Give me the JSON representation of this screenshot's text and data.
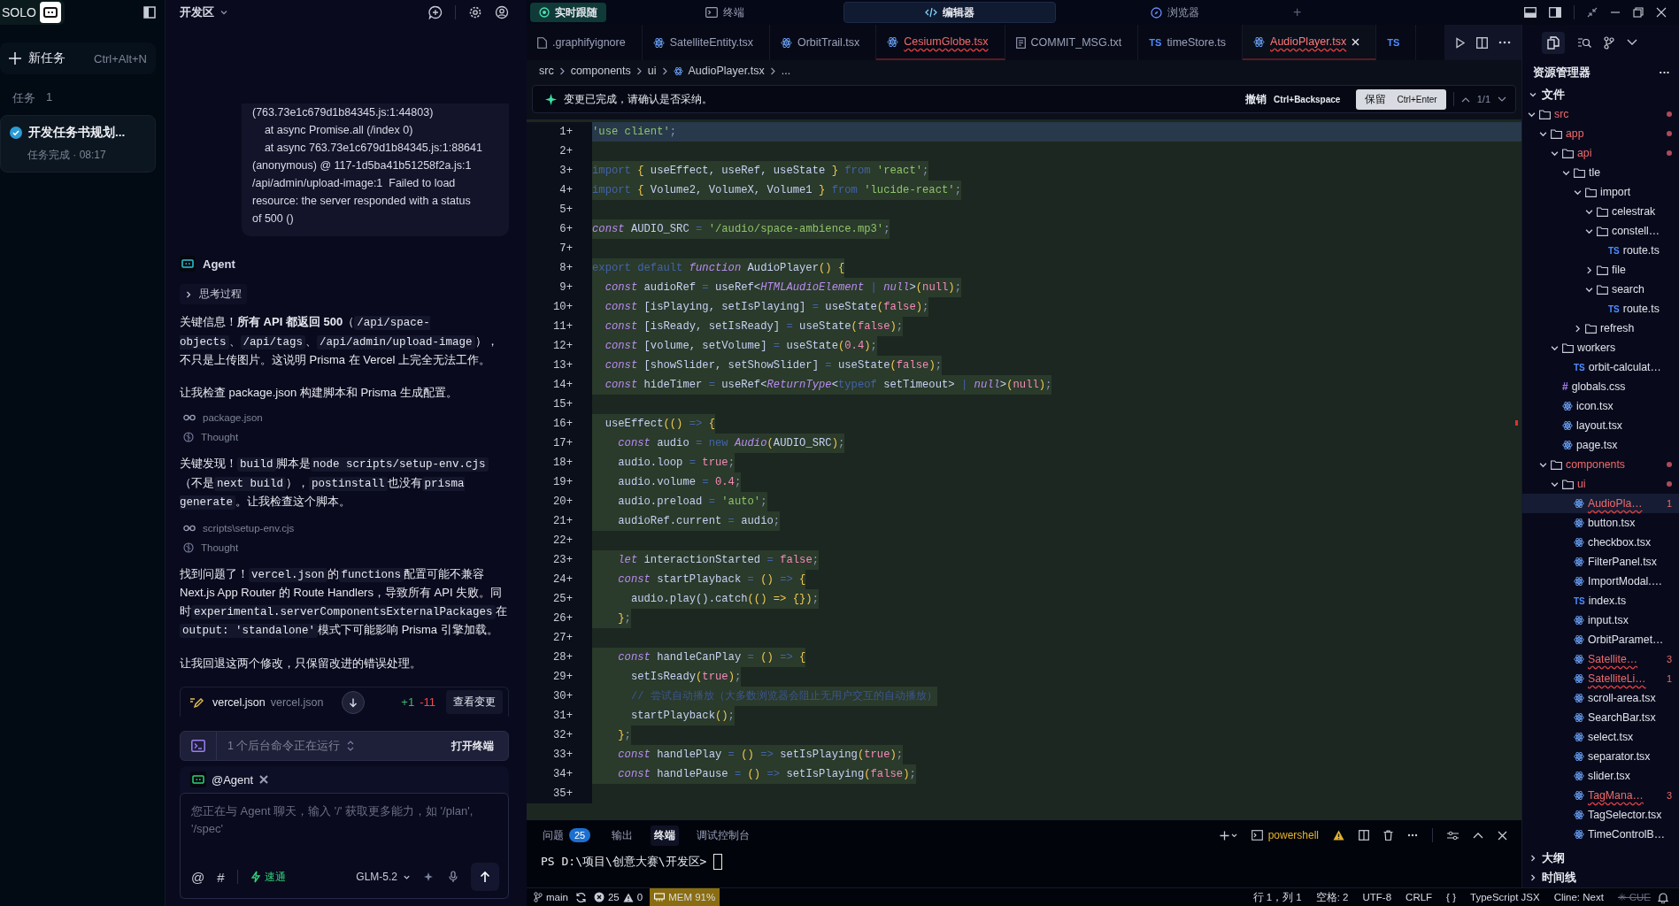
{
  "sidebar": {
    "brand": "SOLO",
    "new_task": {
      "label": "新任务",
      "shortcut": "Ctrl+Alt+N"
    },
    "tasks_label": "任务",
    "tasks_count": "1",
    "tasks": [
      {
        "title": "开发任务书规划...",
        "status": "任务完成 · 08:17",
        "done": true,
        "selected": true
      }
    ]
  },
  "chat": {
    "workspace": "开发区",
    "log": "(763.73e1c679d1b84345.js:1:44803)\n    at async Promise.all (/index 0)\n    at async 763.73e1c679d1b84345.js:1:88641\n(anonymous) @ 117-1d5ba41b51258f2a.js:1\n/api/admin/upload-image:1  Failed to load\nresource: the server responded with a status\nof 500 ()",
    "agent": "Agent",
    "thinking": {
      "label": "思考过程",
      "expanded": false
    },
    "items": [
      {
        "kind": "paragraph",
        "parts": [
          {
            "kind": "plain",
            "text": "关键信息！"
          },
          {
            "kind": "bold",
            "text": "所有 API 都返回 500"
          },
          {
            "kind": "plain",
            "text": "（"
          },
          {
            "kind": "code",
            "text": "/api/space-objects"
          },
          {
            "kind": "plain",
            "text": "、"
          },
          {
            "kind": "code",
            "text": "/api/tags"
          },
          {
            "kind": "plain",
            "text": "、"
          },
          {
            "kind": "code",
            "text": "/api/admin/upload-image"
          },
          {
            "kind": "plain",
            "text": "），不只是上传图片。这说明 Prisma 在 Vercel 上完全无法工作。"
          }
        ]
      },
      {
        "kind": "paragraph",
        "parts": [
          {
            "kind": "plain",
            "text": "让我检查 package.json 构建脚本和 Prisma 生成配置。"
          }
        ]
      },
      {
        "kind": "tool",
        "text": "package.json"
      },
      {
        "kind": "thought",
        "text": "Thought"
      },
      {
        "kind": "paragraph",
        "parts": [
          {
            "kind": "plain",
            "text": "关键发现！"
          },
          {
            "kind": "code",
            "text": "build"
          },
          {
            "kind": "plain",
            "text": "脚本是"
          },
          {
            "kind": "code",
            "text": "node scripts/setup-env.cjs"
          },
          {
            "kind": "plain",
            "text": "（不是"
          },
          {
            "kind": "code",
            "text": "next build"
          },
          {
            "kind": "plain",
            "text": "），"
          },
          {
            "kind": "code",
            "text": "postinstall"
          },
          {
            "kind": "plain",
            "text": "也没有"
          },
          {
            "kind": "code",
            "text": "prisma generate"
          },
          {
            "kind": "plain",
            "text": "。让我检查这个脚本。"
          }
        ]
      },
      {
        "kind": "tool",
        "text": "scripts\\setup-env.cjs"
      },
      {
        "kind": "thought",
        "text": "Thought"
      },
      {
        "kind": "paragraph",
        "parts": [
          {
            "kind": "plain",
            "text": "找到问题了！"
          },
          {
            "kind": "code",
            "text": "vercel.json"
          },
          {
            "kind": "plain",
            "text": "的"
          },
          {
            "kind": "code",
            "text": "functions"
          },
          {
            "kind": "plain",
            "text": "配置可能不兼容 Next.js App Router 的 Route Handlers，导致所有 API 失败。同时"
          },
          {
            "kind": "code",
            "text": "experimental.serverComponentsExternalPackages"
          },
          {
            "kind": "plain",
            "text": "在"
          },
          {
            "kind": "code",
            "text": "output: 'standalone'"
          },
          {
            "kind": "plain",
            "text": "模式下可能影响 Prisma 引擎加载。"
          }
        ]
      },
      {
        "kind": "paragraph",
        "parts": [
          {
            "kind": "plain",
            "text": "让我回退这两个修改，只保留改进的错误处理。"
          }
        ]
      }
    ],
    "change": {
      "file": "vercel.json",
      "path": "vercel.json",
      "added": "+1",
      "removed": "-11",
      "action": "查看变更"
    },
    "background": {
      "label": "1 个后台命令正在运行",
      "action": "打开终端"
    },
    "input": {
      "mention": "@Agent",
      "placeholder": "您正在与 Agent 聊天，输入 '/' 获取更多能力，如 '/plan', '/spec'",
      "at": "@",
      "hash": "#",
      "mode": "速通",
      "model": "GLM-5.2"
    }
  },
  "topbar": {
    "follow": "实时跟随",
    "tabs": [
      {
        "label": "终端",
        "kind": "terminal",
        "selected": false
      },
      {
        "label": "编辑器",
        "kind": "code",
        "selected": true
      },
      {
        "label": "浏览器",
        "kind": "browser",
        "selected": false
      }
    ],
    "add": "+"
  },
  "file_tabs": [
    {
      "name": ".graphifyignore",
      "kind": "file",
      "error": false,
      "selected": false
    },
    {
      "name": "SatelliteEntity.tsx",
      "kind": "react",
      "error": false,
      "selected": false
    },
    {
      "name": "OrbitTrail.tsx",
      "kind": "react",
      "error": false,
      "selected": false
    },
    {
      "name": "CesiumGlobe.tsx",
      "kind": "react",
      "error": true,
      "selected": false
    },
    {
      "name": "COMMIT_MSG.txt",
      "kind": "doc",
      "error": false,
      "selected": false
    },
    {
      "name": "timeStore.ts",
      "kind": "ts",
      "mark": "TS",
      "error": false,
      "selected": false
    },
    {
      "name": "AudioPlayer.tsx",
      "kind": "react",
      "error": true,
      "selected": true
    },
    {
      "kind": "ts",
      "mark": "TS",
      "error": false,
      "selected": false
    }
  ],
  "breadcrumb": [
    "src",
    "components",
    "ui",
    "AudioPlayer.tsx",
    "..."
  ],
  "banner": {
    "message": "变更已完成，请确认是否采纳。",
    "undo": "撤销",
    "undo_key": "Ctrl+Backspace",
    "keep": "保留",
    "keep_key": "Ctrl+Enter",
    "count": "1/1"
  },
  "code": [
    {
      "gutter": "1+",
      "tokens": [
        {
          "kind": "str",
          "text": "'use client'"
        },
        {
          "kind": "p",
          "text": ";"
        }
      ]
    },
    {
      "gutter": "2+"
    },
    {
      "gutter": "3+",
      "tokens": [
        {
          "kind": "kw",
          "text": "import "
        },
        {
          "kind": "br",
          "text": "{ "
        },
        {
          "kind": "id",
          "text": "useEffect, useRef, useState "
        },
        {
          "kind": "br",
          "text": "} "
        },
        {
          "kind": "kw",
          "text": "from "
        },
        {
          "kind": "str",
          "text": "'react'"
        },
        {
          "kind": "p",
          "text": ";"
        }
      ]
    },
    {
      "gutter": "4+",
      "tokens": [
        {
          "kind": "kw",
          "text": "import "
        },
        {
          "kind": "br",
          "text": "{ "
        },
        {
          "kind": "id",
          "text": "Volume2, VolumeX, Volume1 "
        },
        {
          "kind": "br",
          "text": "} "
        },
        {
          "kind": "kw",
          "text": "from "
        },
        {
          "kind": "str",
          "text": "'lucide-react'"
        },
        {
          "kind": "p",
          "text": ";"
        }
      ]
    },
    {
      "gutter": "5+"
    },
    {
      "gutter": "6+",
      "tokens": [
        {
          "kind": "st",
          "text": "const "
        },
        {
          "kind": "id",
          "text": "AUDIO_SRC "
        },
        {
          "kind": "kw",
          "text": "= "
        },
        {
          "kind": "str",
          "text": "'/audio/space-ambience.mp3'"
        },
        {
          "kind": "p",
          "text": ";"
        }
      ]
    },
    {
      "gutter": "7+"
    },
    {
      "gutter": "8+",
      "tokens": [
        {
          "kind": "kw",
          "text": "export default "
        },
        {
          "kind": "st",
          "text": "function "
        },
        {
          "kind": "id",
          "text": "AudioPlayer"
        },
        {
          "kind": "br",
          "text": "() {"
        }
      ]
    },
    {
      "gutter": "9+",
      "tokens": [
        {
          "kind": "st",
          "text": "  const "
        },
        {
          "kind": "id",
          "text": "audioRef "
        },
        {
          "kind": "kw",
          "text": "= "
        },
        {
          "kind": "id",
          "text": "useRef<"
        },
        {
          "kind": "ty",
          "text": "HTMLAudioElement "
        },
        {
          "kind": "kw",
          "text": "| "
        },
        {
          "kind": "ty",
          "text": "null"
        },
        {
          "kind": "id",
          "text": ">"
        },
        {
          "kind": "br",
          "text": "("
        },
        {
          "kind": "lit",
          "text": "null"
        },
        {
          "kind": "br",
          "text": ")"
        },
        {
          "kind": "p",
          "text": ";"
        }
      ]
    },
    {
      "gutter": "10+",
      "tokens": [
        {
          "kind": "st",
          "text": "  const "
        },
        {
          "kind": "id",
          "text": "[isPlaying, setIsPlaying] "
        },
        {
          "kind": "kw",
          "text": "= "
        },
        {
          "kind": "id",
          "text": "useState"
        },
        {
          "kind": "br",
          "text": "("
        },
        {
          "kind": "lit",
          "text": "false"
        },
        {
          "kind": "br",
          "text": ")"
        },
        {
          "kind": "p",
          "text": ";"
        }
      ]
    },
    {
      "gutter": "11+",
      "tokens": [
        {
          "kind": "st",
          "text": "  const "
        },
        {
          "kind": "id",
          "text": "[isReady, setIsReady] "
        },
        {
          "kind": "kw",
          "text": "= "
        },
        {
          "kind": "id",
          "text": "useState"
        },
        {
          "kind": "br",
          "text": "("
        },
        {
          "kind": "lit",
          "text": "false"
        },
        {
          "kind": "br",
          "text": ")"
        },
        {
          "kind": "p",
          "text": ";"
        }
      ]
    },
    {
      "gutter": "12+",
      "tokens": [
        {
          "kind": "st",
          "text": "  const "
        },
        {
          "kind": "id",
          "text": "[volume, setVolume] "
        },
        {
          "kind": "kw",
          "text": "= "
        },
        {
          "kind": "id",
          "text": "useState"
        },
        {
          "kind": "br",
          "text": "("
        },
        {
          "kind": "lit",
          "text": "0.4"
        },
        {
          "kind": "br",
          "text": ")"
        },
        {
          "kind": "p",
          "text": ";"
        }
      ]
    },
    {
      "gutter": "13+",
      "tokens": [
        {
          "kind": "st",
          "text": "  const "
        },
        {
          "kind": "id",
          "text": "[showSlider, setShowSlider] "
        },
        {
          "kind": "kw",
          "text": "= "
        },
        {
          "kind": "id",
          "text": "useState"
        },
        {
          "kind": "br",
          "text": "("
        },
        {
          "kind": "lit",
          "text": "false"
        },
        {
          "kind": "br",
          "text": ")"
        },
        {
          "kind": "p",
          "text": ";"
        }
      ]
    },
    {
      "gutter": "14+",
      "tokens": [
        {
          "kind": "st",
          "text": "  const "
        },
        {
          "kind": "id",
          "text": "hideTimer "
        },
        {
          "kind": "kw",
          "text": "= "
        },
        {
          "kind": "id",
          "text": "useRef<"
        },
        {
          "kind": "ty",
          "text": "ReturnType"
        },
        {
          "kind": "id",
          "text": "<"
        },
        {
          "kind": "kw",
          "text": "typeof "
        },
        {
          "kind": "id",
          "text": "setTimeout> "
        },
        {
          "kind": "kw",
          "text": "| "
        },
        {
          "kind": "ty",
          "text": "null"
        },
        {
          "kind": "id",
          "text": ">"
        },
        {
          "kind": "br",
          "text": "("
        },
        {
          "kind": "lit",
          "text": "null"
        },
        {
          "kind": "br",
          "text": ")"
        },
        {
          "kind": "p",
          "text": ";"
        }
      ]
    },
    {
      "gutter": "15+"
    },
    {
      "gutter": "16+",
      "tokens": [
        {
          "kind": "id",
          "text": "  useEffect"
        },
        {
          "kind": "br",
          "text": "(() "
        },
        {
          "kind": "kw",
          "text": "=> "
        },
        {
          "kind": "br",
          "text": "{"
        }
      ]
    },
    {
      "gutter": "17+",
      "tokens": [
        {
          "kind": "st",
          "text": "    const "
        },
        {
          "kind": "id",
          "text": "audio "
        },
        {
          "kind": "kw",
          "text": "= new "
        },
        {
          "kind": "ty",
          "text": "Audio"
        },
        {
          "kind": "br",
          "text": "("
        },
        {
          "kind": "id",
          "text": "AUDIO_SRC"
        },
        {
          "kind": "br",
          "text": ")"
        },
        {
          "kind": "p",
          "text": ";"
        }
      ]
    },
    {
      "gutter": "18+",
      "tokens": [
        {
          "kind": "id",
          "text": "    audio.loop "
        },
        {
          "kind": "kw",
          "text": "= "
        },
        {
          "kind": "lit",
          "text": "true"
        },
        {
          "kind": "p",
          "text": ";"
        }
      ]
    },
    {
      "gutter": "19+",
      "tokens": [
        {
          "kind": "id",
          "text": "    audio.volume "
        },
        {
          "kind": "kw",
          "text": "= "
        },
        {
          "kind": "lit",
          "text": "0.4"
        },
        {
          "kind": "p",
          "text": ";"
        }
      ]
    },
    {
      "gutter": "20+",
      "tokens": [
        {
          "kind": "id",
          "text": "    audio.preload "
        },
        {
          "kind": "kw",
          "text": "= "
        },
        {
          "kind": "str",
          "text": "'auto'"
        },
        {
          "kind": "p",
          "text": ";"
        }
      ]
    },
    {
      "gutter": "21+",
      "tokens": [
        {
          "kind": "id",
          "text": "    audioRef.current "
        },
        {
          "kind": "kw",
          "text": "= "
        },
        {
          "kind": "id",
          "text": "audio"
        },
        {
          "kind": "p",
          "text": ";"
        }
      ]
    },
    {
      "gutter": "22+"
    },
    {
      "gutter": "23+",
      "tokens": [
        {
          "kind": "st",
          "text": "    let "
        },
        {
          "kind": "id",
          "text": "interactionStarted "
        },
        {
          "kind": "kw",
          "text": "= "
        },
        {
          "kind": "lit",
          "text": "false"
        },
        {
          "kind": "p",
          "text": ";"
        }
      ]
    },
    {
      "gutter": "24+",
      "tokens": [
        {
          "kind": "st",
          "text": "    const "
        },
        {
          "kind": "id",
          "text": "startPlayback "
        },
        {
          "kind": "kw",
          "text": "= "
        },
        {
          "kind": "br",
          "text": "() "
        },
        {
          "kind": "kw",
          "text": "=> "
        },
        {
          "kind": "br",
          "text": "{"
        }
      ]
    },
    {
      "gutter": "25+",
      "tokens": [
        {
          "kind": "id",
          "text": "      audio.play().catch"
        },
        {
          "kind": "br",
          "text": "(() => {})"
        },
        {
          "kind": "p",
          "text": ";"
        }
      ]
    },
    {
      "gutter": "26+",
      "tokens": [
        {
          "kind": "br",
          "text": "    }"
        },
        {
          "kind": "p",
          "text": ";"
        }
      ]
    },
    {
      "gutter": "27+"
    },
    {
      "gutter": "28+",
      "tokens": [
        {
          "kind": "st",
          "text": "    const "
        },
        {
          "kind": "id",
          "text": "handleCanPlay "
        },
        {
          "kind": "kw",
          "text": "= "
        },
        {
          "kind": "br",
          "text": "() "
        },
        {
          "kind": "kw",
          "text": "=> "
        },
        {
          "kind": "br",
          "text": "{"
        }
      ]
    },
    {
      "gutter": "29+",
      "tokens": [
        {
          "kind": "id",
          "text": "      setIsReady"
        },
        {
          "kind": "br",
          "text": "("
        },
        {
          "kind": "lit",
          "text": "true"
        },
        {
          "kind": "br",
          "text": ")"
        },
        {
          "kind": "p",
          "text": ";"
        }
      ]
    },
    {
      "gutter": "30+",
      "tokens": [
        {
          "kind": "cm",
          "text": "      // 尝试自动播放（大多数浏览器会阻止无用户交互的自动播放）"
        }
      ]
    },
    {
      "gutter": "31+",
      "tokens": [
        {
          "kind": "id",
          "text": "      startPlayback"
        },
        {
          "kind": "br",
          "text": "()"
        },
        {
          "kind": "p",
          "text": ";"
        }
      ]
    },
    {
      "gutter": "32+",
      "tokens": [
        {
          "kind": "br",
          "text": "    }"
        },
        {
          "kind": "p",
          "text": ";"
        }
      ]
    },
    {
      "gutter": "33+",
      "tokens": [
        {
          "kind": "st",
          "text": "    const "
        },
        {
          "kind": "id",
          "text": "handlePlay "
        },
        {
          "kind": "kw",
          "text": "= "
        },
        {
          "kind": "br",
          "text": "() "
        },
        {
          "kind": "kw",
          "text": "=> "
        },
        {
          "kind": "id",
          "text": "setIsPlaying"
        },
        {
          "kind": "br",
          "text": "("
        },
        {
          "kind": "lit",
          "text": "true"
        },
        {
          "kind": "br",
          "text": ")"
        },
        {
          "kind": "p",
          "text": ";"
        }
      ]
    },
    {
      "gutter": "34+",
      "tokens": [
        {
          "kind": "st",
          "text": "    const "
        },
        {
          "kind": "id",
          "text": "handlePause "
        },
        {
          "kind": "kw",
          "text": "= "
        },
        {
          "kind": "br",
          "text": "() "
        },
        {
          "kind": "kw",
          "text": "=> "
        },
        {
          "kind": "id",
          "text": "setIsPlaying"
        },
        {
          "kind": "br",
          "text": "("
        },
        {
          "kind": "lit",
          "text": "false"
        },
        {
          "kind": "br",
          "text": ")"
        },
        {
          "kind": "p",
          "text": ";"
        }
      ]
    },
    {
      "gutter": "35+"
    }
  ],
  "panel": {
    "tabs": [
      {
        "label": "问题",
        "badge": "25",
        "selected": false
      },
      {
        "label": "输出",
        "selected": false
      },
      {
        "label": "终端",
        "selected": true
      },
      {
        "label": "调试控制台",
        "selected": false
      }
    ],
    "shell": "powershell",
    "prompt": "PS D:\\项目\\创意大赛\\开发区> "
  },
  "explorer": {
    "title": "资源管理器",
    "more": "···",
    "files": {
      "label": "文件",
      "expanded": true,
      "tree": [
        {
          "name": "src",
          "kind": "folder",
          "expanded": true,
          "modified": true,
          "selected": false,
          "children": [
            {
              "name": "app",
              "kind": "folder",
              "expanded": true,
              "modified": true,
              "selected": false,
              "children": [
                {
                  "name": "api",
                  "kind": "folder",
                  "expanded": true,
                  "modified": true,
                  "selected": false,
                  "children": [
                    {
                      "name": "tle",
                      "kind": "folder",
                      "expanded": true,
                      "modified": false,
                      "selected": false,
                      "children": [
                        {
                          "name": "import",
                          "kind": "folder",
                          "expanded": true,
                          "modified": false,
                          "selected": false,
                          "children": [
                            {
                              "name": "celestrak",
                              "kind": "folder",
                              "expanded": true,
                              "modified": false,
                              "selected": false
                            },
                            {
                              "name": "constell…",
                              "kind": "folder",
                              "expanded": true,
                              "modified": false,
                              "selected": false,
                              "children": [
                                {
                                  "name": "route.ts",
                                  "kind": "ts",
                                  "mark": "TS",
                                  "modified": false,
                                  "selected": false
                                }
                              ]
                            },
                            {
                              "name": "file",
                              "kind": "folder",
                              "expanded": false,
                              "modified": false,
                              "selected": false
                            },
                            {
                              "name": "search",
                              "kind": "folder",
                              "expanded": true,
                              "modified": false,
                              "selected": false,
                              "children": [
                                {
                                  "name": "route.ts",
                                  "kind": "ts",
                                  "mark": "TS",
                                  "modified": false,
                                  "selected": false
                                }
                              ]
                            }
                          ]
                        },
                        {
                          "name": "refresh",
                          "kind": "folder",
                          "expanded": false,
                          "modified": false,
                          "selected": false
                        }
                      ]
                    }
                  ]
                },
                {
                  "name": "workers",
                  "kind": "folder",
                  "expanded": true,
                  "modified": false,
                  "selected": false,
                  "children": [
                    {
                      "name": "orbit-calculat…",
                      "kind": "ts",
                      "mark": "TS",
                      "modified": false,
                      "selected": false
                    }
                  ]
                },
                {
                  "name": "globals.css",
                  "kind": "css",
                  "mark": "#",
                  "modified": false,
                  "selected": false
                },
                {
                  "name": "icon.tsx",
                  "kind": "react",
                  "modified": false,
                  "selected": false
                },
                {
                  "name": "layout.tsx",
                  "kind": "react",
                  "modified": false,
                  "selected": false
                },
                {
                  "name": "page.tsx",
                  "kind": "react",
                  "modified": false,
                  "selected": false
                }
              ]
            },
            {
              "name": "components",
              "kind": "folder",
              "expanded": true,
              "modified": true,
              "selected": false,
              "children": [
                {
                  "name": "ui",
                  "kind": "folder",
                  "expanded": true,
                  "modified": true,
                  "selected": false,
                  "children": [
                    {
                      "name": "AudioPla…",
                      "kind": "react",
                      "modified": true,
                      "badge": "1",
                      "selected": true
                    },
                    {
                      "name": "button.tsx",
                      "kind": "react",
                      "modified": false,
                      "selected": false
                    },
                    {
                      "name": "checkbox.tsx",
                      "kind": "react",
                      "modified": false,
                      "selected": false
                    },
                    {
                      "name": "FilterPanel.tsx",
                      "kind": "react",
                      "modified": false,
                      "selected": false
                    },
                    {
                      "name": "ImportModal.…",
                      "kind": "react",
                      "modified": false,
                      "selected": false
                    },
                    {
                      "name": "index.ts",
                      "kind": "ts",
                      "mark": "TS",
                      "modified": false,
                      "selected": false
                    },
                    {
                      "name": "input.tsx",
                      "kind": "react",
                      "modified": false,
                      "selected": false
                    },
                    {
                      "name": "OrbitParamet…",
                      "kind": "react",
                      "modified": false,
                      "selected": false
                    },
                    {
                      "name": "Satellite…",
                      "kind": "react",
                      "modified": true,
                      "badge": "3",
                      "selected": false
                    },
                    {
                      "name": "SatelliteLi…",
                      "kind": "react",
                      "modified": true,
                      "badge": "1",
                      "selected": false
                    },
                    {
                      "name": "scroll-area.tsx",
                      "kind": "react",
                      "modified": false,
                      "selected": false
                    },
                    {
                      "name": "SearchBar.tsx",
                      "kind": "react",
                      "modified": false,
                      "selected": false
                    },
                    {
                      "name": "select.tsx",
                      "kind": "react",
                      "modified": false,
                      "selected": false
                    },
                    {
                      "name": "separator.tsx",
                      "kind": "react",
                      "modified": false,
                      "selected": false
                    },
                    {
                      "name": "slider.tsx",
                      "kind": "react",
                      "modified": false,
                      "selected": false
                    },
                    {
                      "name": "TagMana…",
                      "kind": "react",
                      "modified": true,
                      "badge": "3",
                      "selected": false
                    },
                    {
                      "name": "TagSelector.tsx",
                      "kind": "react",
                      "modified": false,
                      "selected": false
                    },
                    {
                      "name": "TimeControlB…",
                      "kind": "react",
                      "modified": false,
                      "selected": false
                    }
                  ]
                }
              ]
            }
          ]
        }
      ]
    },
    "sections": [
      {
        "label": "大纲",
        "expanded": false
      },
      {
        "label": "时间线",
        "expanded": false
      }
    ]
  },
  "status": {
    "branch": "main",
    "errors": "25",
    "warnings": "0",
    "memory": "MEM 91%",
    "memory_warning": true,
    "right": [
      "行 1，列 1",
      "空格: 2",
      "UTF-8",
      "CRLF",
      "{ }",
      "TypeScript JSX",
      "Cline: Next"
    ],
    "cue": "✳ CUE"
  }
}
